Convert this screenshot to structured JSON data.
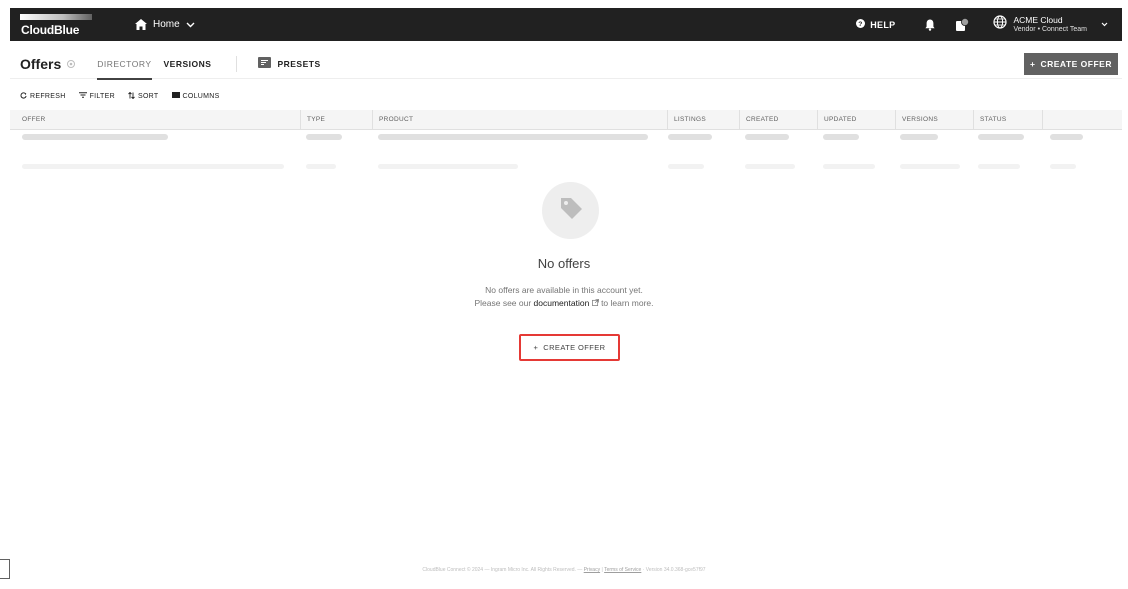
{
  "topbar": {
    "brand": "CloudBlue",
    "home_label": "Home",
    "help_label": "HELP",
    "account_name": "ACME Cloud",
    "account_team": "Vendor • Connect Team"
  },
  "header": {
    "title": "Offers",
    "tabs": [
      {
        "label": "DIRECTORY"
      },
      {
        "label": "VERSIONS"
      }
    ],
    "presets_label": "PRESETS",
    "create_label": "CREATE OFFER"
  },
  "toolbar": {
    "refresh": "REFRESH",
    "filter": "FILTER",
    "sort": "SORT",
    "columns": "COLUMNS"
  },
  "table": {
    "columns": [
      "OFFER",
      "TYPE",
      "PRODUCT",
      "LISTINGS",
      "CREATED",
      "UPDATED",
      "VERSIONS",
      "STATUS"
    ]
  },
  "empty_state": {
    "title": "No offers",
    "line1": "No offers are available in this account yet.",
    "line2_prefix": "Please see our",
    "link_text": "documentation",
    "line2_suffix": "to learn more.",
    "button_label": "CREATE OFFER"
  },
  "footer": {
    "copyright": "CloudBlue Connect © 2024 — Ingram Micro Inc. All Rights Reserved. —",
    "privacy": "Privacy",
    "sep": "|",
    "terms": "Terms of Service",
    "version": "· Version 34.0.368-gce57f97"
  },
  "colors": {
    "topbar_bg": "#212121",
    "primary_button": "#616161",
    "highlight_border": "#e53935"
  }
}
